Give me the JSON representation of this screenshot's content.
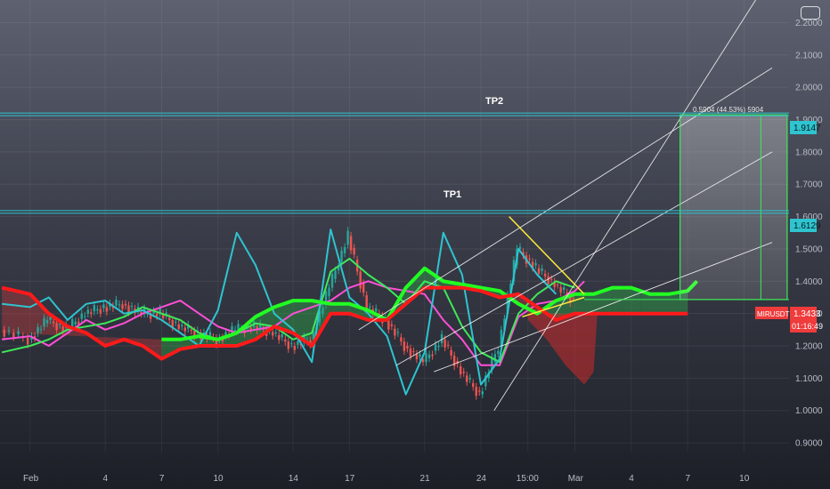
{
  "chart_data": {
    "type": "line",
    "symbol": "MIRUSDT",
    "current_price": "1.3433",
    "countdown": "01:16:49",
    "y_ticks": [
      0.9,
      1.0,
      1.1,
      1.2,
      1.3,
      1.4,
      1.5,
      1.6,
      1.7,
      1.8,
      1.9,
      2.0,
      2.1,
      2.2
    ],
    "x_tick_labels": [
      "Feb",
      "4",
      "7",
      "10",
      "14",
      "17",
      "21",
      "24",
      "15:00",
      "Mar",
      "4",
      "7",
      "10"
    ],
    "x_tick_index": [
      0,
      4,
      7,
      10,
      14,
      17,
      21,
      24,
      26.5,
      29,
      32,
      35,
      38
    ],
    "ylim": [
      0.87,
      2.27
    ],
    "xlim": [
      -1.6,
      40.4
    ],
    "levels": [
      {
        "name": "TP2",
        "value": 1.9147,
        "label": "1.9147"
      },
      {
        "name": "TP1",
        "value": 1.6129,
        "label": "1.6129"
      }
    ],
    "measure_label": "0.5904 (44.53%) 5904",
    "annotations": [
      "TP2",
      "TP1"
    ],
    "series": [
      {
        "role": "conversion",
        "color": "#ff4fd8",
        "x": [
          -1.5,
          0,
          1,
          2,
          3,
          4,
          5,
          6,
          7,
          8,
          9,
          10,
          11,
          12,
          13,
          14,
          15,
          16,
          17,
          18,
          19,
          20,
          21,
          22,
          23,
          24,
          25,
          26,
          27,
          28,
          29,
          29.5
        ],
        "y": [
          1.22,
          1.23,
          1.2,
          1.24,
          1.28,
          1.25,
          1.27,
          1.3,
          1.32,
          1.34,
          1.3,
          1.26,
          1.24,
          1.25,
          1.26,
          1.3,
          1.32,
          1.34,
          1.38,
          1.4,
          1.38,
          1.37,
          1.36,
          1.28,
          1.22,
          1.14,
          1.14,
          1.29,
          1.33,
          1.34,
          1.37,
          1.4
        ]
      },
      {
        "role": "base",
        "color": "#3ee85a",
        "x": [
          -1.5,
          0,
          1,
          2,
          3,
          4,
          5,
          6,
          7,
          8,
          9,
          10,
          11,
          12,
          13,
          14,
          15,
          16,
          17,
          18,
          19,
          20,
          21,
          22,
          23,
          24,
          25,
          26,
          27,
          28,
          29
        ],
        "y": [
          1.18,
          1.2,
          1.22,
          1.25,
          1.26,
          1.27,
          1.29,
          1.32,
          1.3,
          1.28,
          1.24,
          1.22,
          1.24,
          1.27,
          1.26,
          1.22,
          1.24,
          1.43,
          1.47,
          1.42,
          1.38,
          1.33,
          1.4,
          1.38,
          1.26,
          1.18,
          1.15,
          1.3,
          1.36,
          1.4,
          1.38
        ]
      },
      {
        "role": "lagging",
        "color": "#2ec4d0",
        "x": [
          -1.5,
          0,
          1,
          2,
          3,
          4,
          5,
          6,
          7,
          8,
          9,
          10,
          11,
          12,
          13,
          14,
          15,
          16,
          17,
          18,
          19,
          20,
          21,
          22,
          23,
          24,
          25,
          26,
          27,
          28
        ],
        "y": [
          1.33,
          1.32,
          1.35,
          1.28,
          1.33,
          1.34,
          1.3,
          1.31,
          1.28,
          1.24,
          1.2,
          1.31,
          1.55,
          1.45,
          1.3,
          1.25,
          1.15,
          1.56,
          1.35,
          1.3,
          1.23,
          1.05,
          1.18,
          1.55,
          1.42,
          1.08,
          1.16,
          1.5,
          1.42,
          1.36
        ]
      },
      {
        "role": "span-a",
        "color": "#22ff22",
        "x": [
          7,
          8,
          9,
          10,
          11,
          12,
          13,
          14,
          15,
          16,
          17,
          18,
          19,
          20,
          21,
          22,
          23,
          24,
          25,
          26,
          27,
          28,
          29,
          30,
          31,
          32,
          33,
          34,
          35,
          35.5
        ],
        "y": [
          1.22,
          1.22,
          1.23,
          1.22,
          1.24,
          1.29,
          1.32,
          1.34,
          1.34,
          1.33,
          1.33,
          1.31,
          1.28,
          1.38,
          1.44,
          1.4,
          1.39,
          1.38,
          1.37,
          1.33,
          1.3,
          1.34,
          1.36,
          1.36,
          1.38,
          1.38,
          1.36,
          1.36,
          1.37,
          1.4
        ]
      },
      {
        "role": "span-b",
        "color": "#ff1a1a",
        "x": [
          -1.5,
          0,
          1,
          2,
          3,
          4,
          5,
          6,
          7,
          8,
          9,
          10,
          11,
          12,
          13,
          14,
          15,
          16,
          17,
          18,
          19,
          20,
          21,
          22,
          23,
          24,
          25,
          26,
          27,
          28,
          29,
          30,
          31,
          32,
          33,
          34,
          35
        ],
        "y": [
          1.38,
          1.36,
          1.3,
          1.26,
          1.24,
          1.2,
          1.22,
          1.2,
          1.16,
          1.19,
          1.2,
          1.2,
          1.2,
          1.22,
          1.26,
          1.24,
          1.2,
          1.3,
          1.3,
          1.28,
          1.28,
          1.33,
          1.38,
          1.38,
          1.38,
          1.37,
          1.35,
          1.36,
          1.32,
          1.28,
          1.3,
          1.3,
          1.3,
          1.3,
          1.3,
          1.3,
          1.3
        ]
      },
      {
        "role": "price",
        "color": "#26a69a",
        "x": [
          -1.5,
          0,
          1,
          2,
          3,
          4,
          5,
          6,
          7,
          8,
          9,
          10,
          11,
          12,
          13,
          14,
          15,
          16,
          17,
          18,
          19,
          20,
          21,
          22,
          23,
          24,
          25,
          26,
          27,
          28,
          29
        ],
        "y": [
          1.25,
          1.22,
          1.28,
          1.25,
          1.3,
          1.32,
          1.33,
          1.3,
          1.3,
          1.26,
          1.24,
          1.22,
          1.25,
          1.26,
          1.24,
          1.2,
          1.22,
          1.38,
          1.54,
          1.32,
          1.28,
          1.2,
          1.15,
          1.22,
          1.12,
          1.05,
          1.2,
          1.5,
          1.44,
          1.39,
          1.34
        ]
      }
    ],
    "channels": [
      {
        "x": [
          24.7,
          39.5
        ],
        "y": [
          1.0,
          2.35
        ]
      },
      {
        "x": [
          19.5,
          39.5
        ],
        "y": [
          1.14,
          1.8
        ]
      },
      {
        "x": [
          17.5,
          39.5
        ],
        "y": [
          1.25,
          2.06
        ]
      },
      {
        "x": [
          21.5,
          39.5
        ],
        "y": [
          1.12,
          1.52
        ]
      }
    ],
    "triangle": {
      "upper": {
        "x": [
          25.5,
          29.5
        ],
        "y": [
          1.6,
          1.36
        ]
      },
      "lower": {
        "x": [
          26.2,
          29.5
        ],
        "y": [
          1.29,
          1.35
        ]
      }
    },
    "target_box": {
      "x": [
        34.6,
        40.3
      ],
      "y": [
        1.3433,
        1.9147
      ]
    },
    "zone_red": {
      "x": [
        26.5,
        27.5,
        28.5,
        29.5,
        30.2,
        30.0,
        29.5,
        28.5,
        27.5,
        26.5
      ],
      "y": [
        1.32,
        1.3,
        1.3,
        1.3,
        1.3,
        1.12,
        1.08,
        1.14,
        1.22,
        1.28
      ]
    }
  }
}
